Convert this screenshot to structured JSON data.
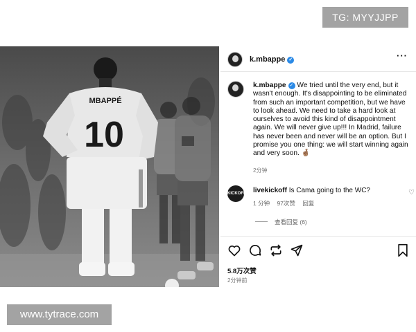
{
  "watermarks": {
    "top": "TG: MYYJJPP",
    "bottom": "www.tytrace.com"
  },
  "post": {
    "username": "k.mbappe",
    "jersey_name": "MBAPPÉ",
    "jersey_number": "10",
    "caption": "We tried until the very end, but it wasn't enough. It's disappointing to be eliminated from such an important competition, but we have to look ahead. We need to take a hard look at ourselves to avoid this kind of disappointment again. We will never give up!!! In Madrid, failure has never been and never will be an option. But I promise you one thing: we will start winning again and very soon. 🤞🏽",
    "caption_time": "2分钟",
    "likes": "5.8万次赞",
    "post_time": "2分钟前"
  },
  "comment": {
    "username": "livekickoff",
    "avatar_text": "KICKOFF",
    "text": "Is Cama going to the WC?",
    "time": "1 分钟",
    "likes": "97次赞",
    "reply": "回复",
    "view_replies": "查看回复 (6)"
  },
  "icons": [
    "heart-icon",
    "comment-icon",
    "repost-icon",
    "share-icon",
    "bookmark-icon",
    "more-icon",
    "verified-icon"
  ]
}
